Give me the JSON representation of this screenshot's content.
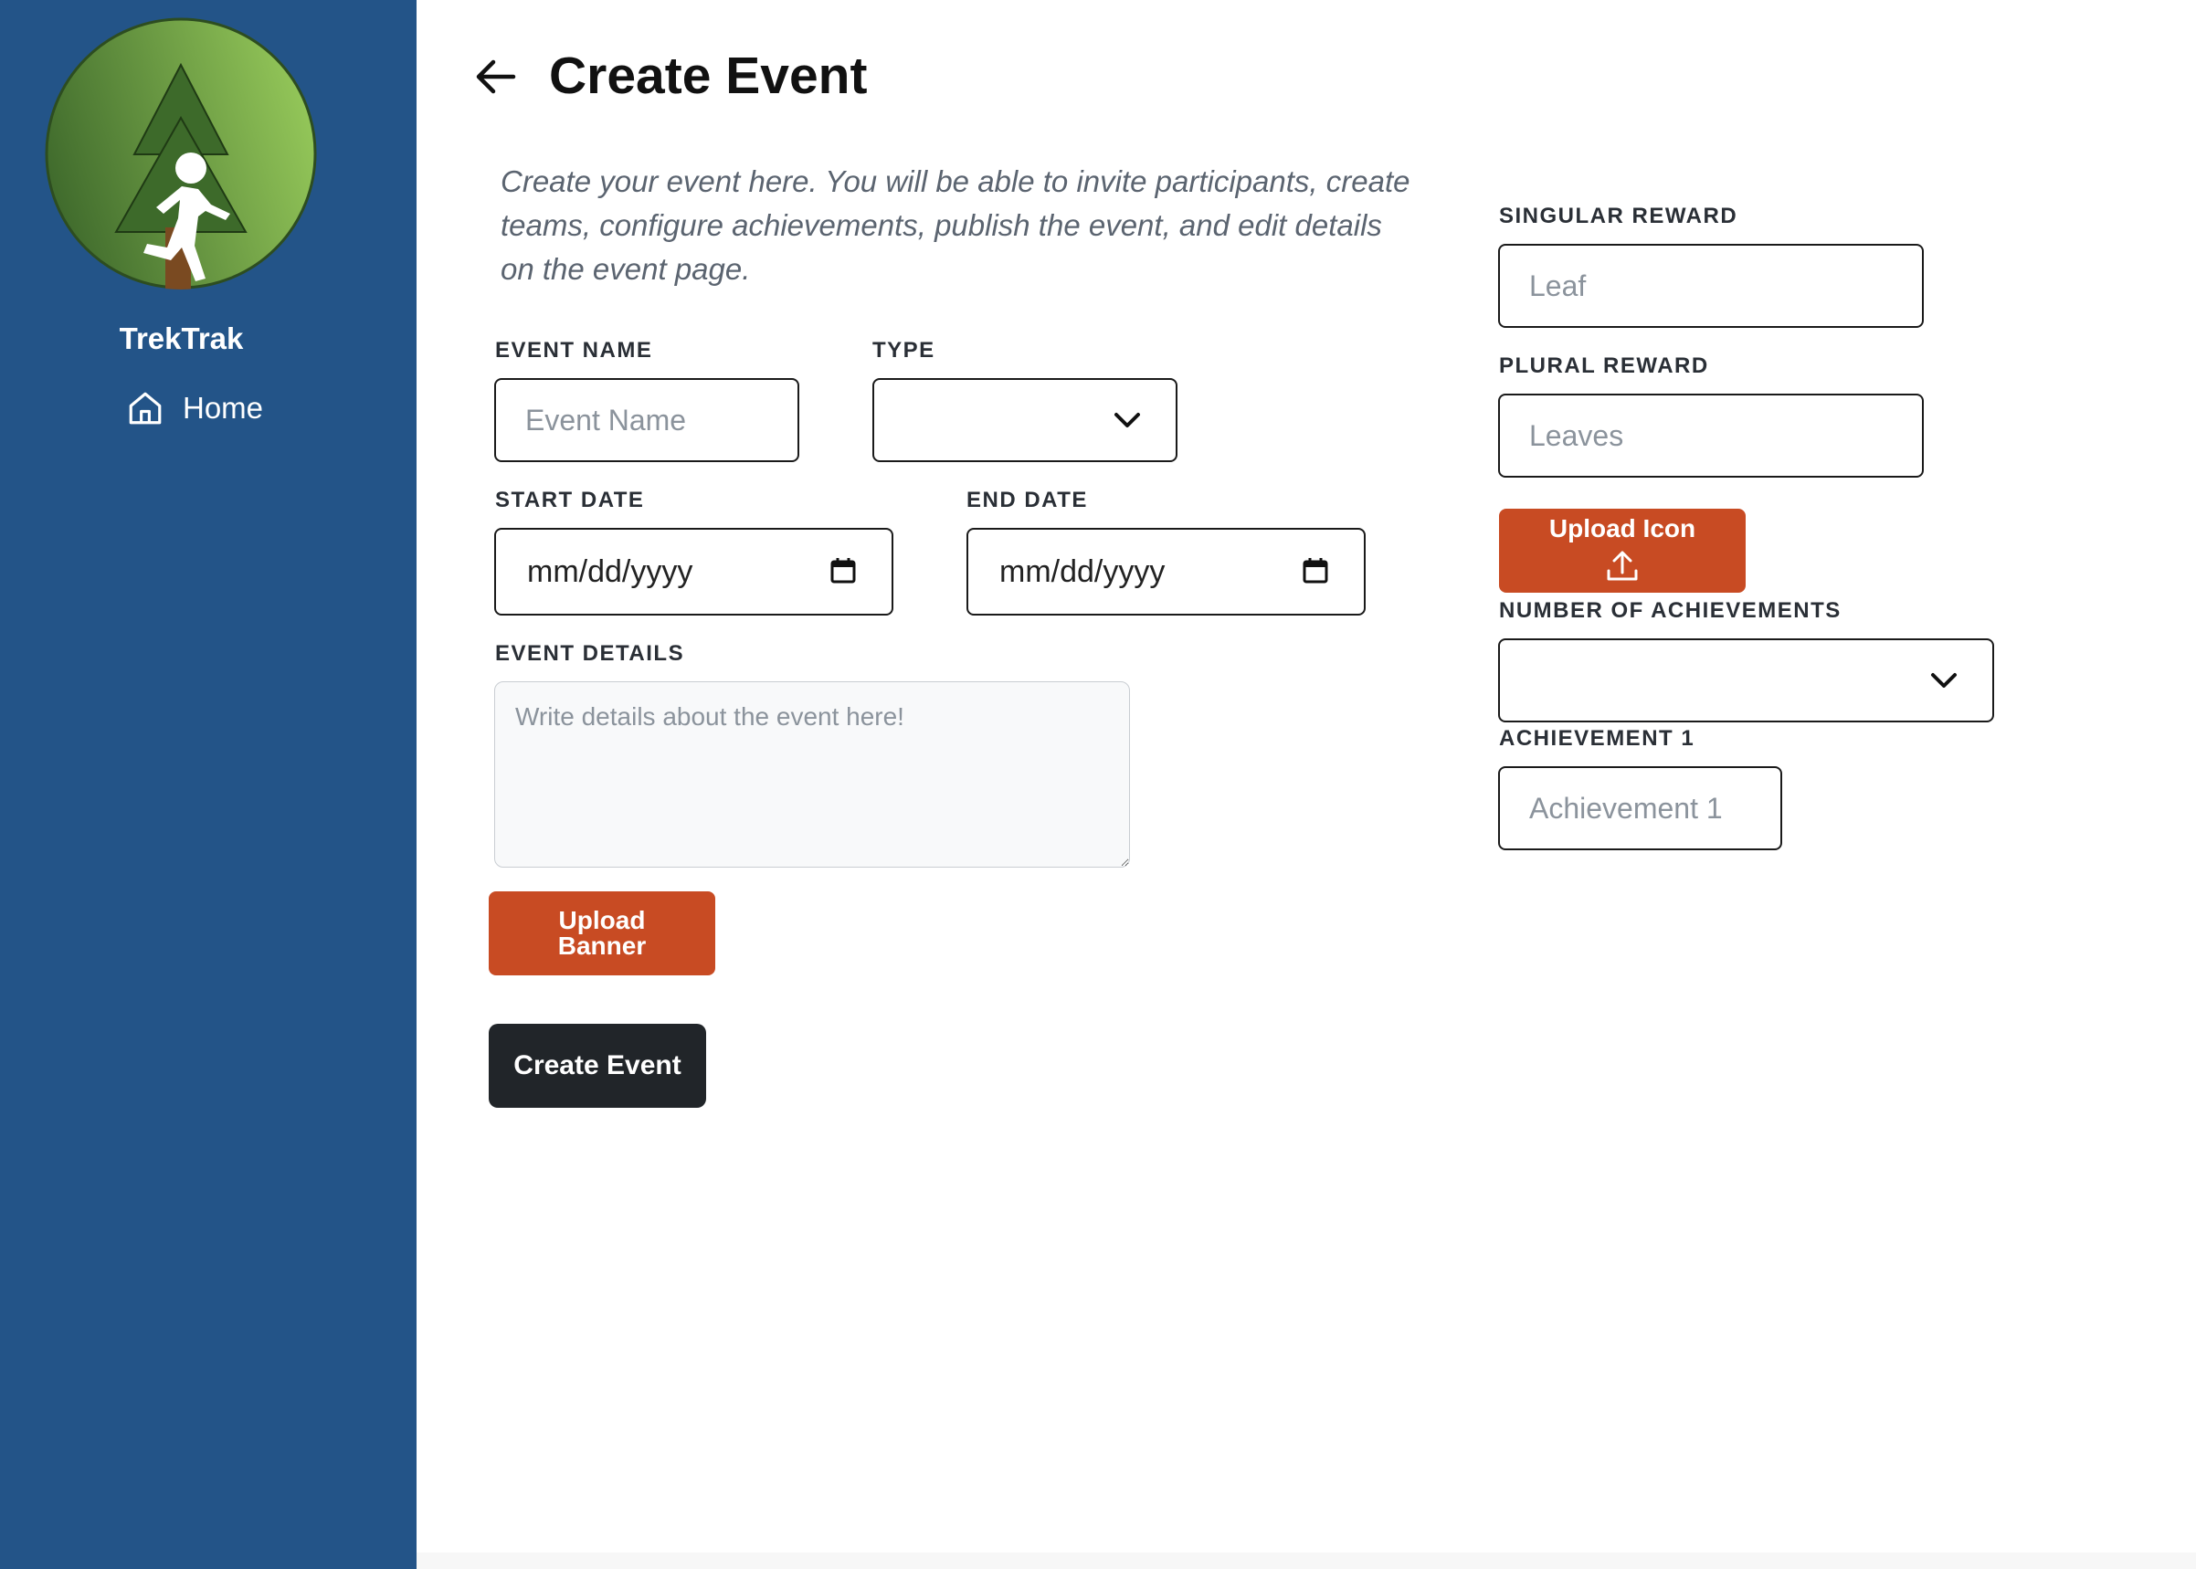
{
  "sidebar": {
    "brand": "TrekTrak",
    "nav": [
      {
        "label": "Home",
        "icon": "home-icon"
      }
    ]
  },
  "header": {
    "title": "Create Event",
    "back_icon": "arrow-left-icon"
  },
  "description": "Create your event here. You will be able to invite participants, create teams, configure achievements, publish the event, and edit details on the event page.",
  "form": {
    "event_name": {
      "label": "EVENT NAME",
      "placeholder": "Event Name",
      "value": ""
    },
    "type": {
      "label": "TYPE",
      "selected": ""
    },
    "start_date": {
      "label": "START DATE",
      "value": "mm/dd/yyyy"
    },
    "end_date": {
      "label": "END DATE",
      "value": "mm/dd/yyyy"
    },
    "event_details": {
      "label": "EVENT DETAILS",
      "placeholder": "Write details about the event here!"
    },
    "upload_banner": {
      "line1": "Upload",
      "line2": "Banner"
    },
    "submit_label": "Create Event"
  },
  "rewards": {
    "singular": {
      "label": "SINGULAR REWARD",
      "placeholder": "Leaf"
    },
    "plural": {
      "label": "PLURAL REWARD",
      "placeholder": "Leaves"
    },
    "upload_icon_label": "Upload Icon",
    "num_achievements": {
      "label": "NUMBER OF ACHIEVEMENTS",
      "selected": ""
    },
    "achievements": [
      {
        "label": "ACHIEVEMENT 1",
        "placeholder": "Achievement 1"
      }
    ]
  },
  "colors": {
    "sidebar": "#235488",
    "accent": "#c84b23",
    "dark_button": "#212529",
    "logo_green_dark": "#3f6a2c",
    "logo_green_light": "#96c95a"
  }
}
